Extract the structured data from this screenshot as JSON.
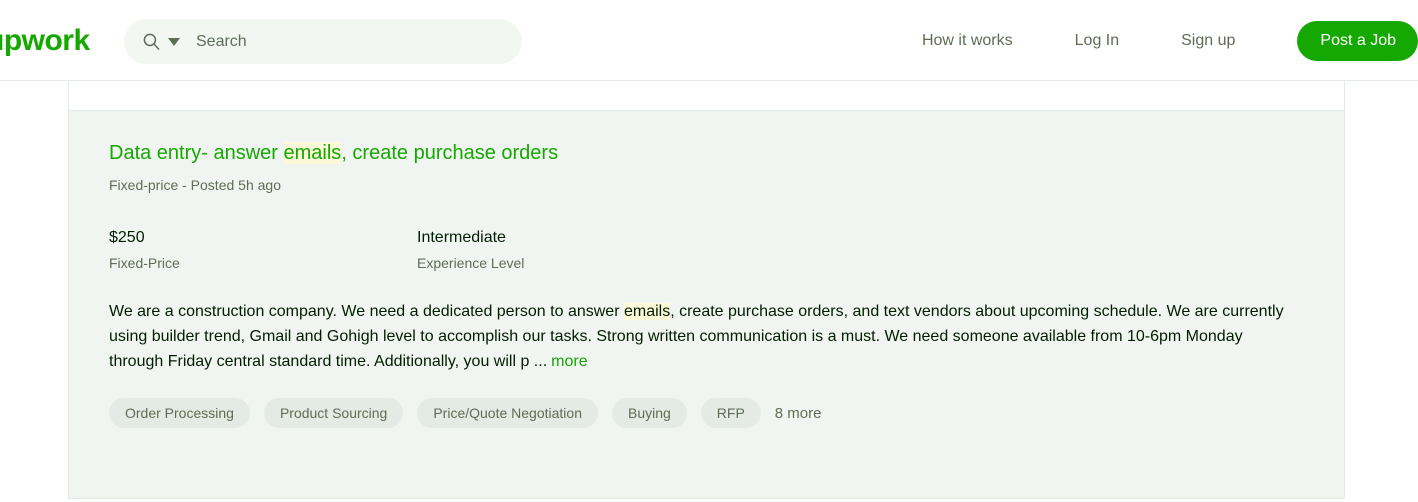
{
  "header": {
    "logo_text": "upwork",
    "logo_color": "#14a800",
    "search": {
      "placeholder": "Search",
      "value": "",
      "icon": "search-icon",
      "caret_icon": "chevron-down-icon"
    },
    "nav": [
      {
        "label": "How it works"
      },
      {
        "label": "Log In"
      },
      {
        "label": "Sign up"
      }
    ],
    "cta_label": "Post a Job"
  },
  "job": {
    "title_before": "Data entry- answer ",
    "title_highlight": "emails",
    "title_after": ", create purchase orders",
    "meta": "Fixed-price - Posted 5h ago",
    "stats": [
      {
        "value": "$250",
        "label": "Fixed-Price"
      },
      {
        "value": "Intermediate",
        "label": "Experience Level"
      }
    ],
    "description_before": "We are a construction company. We need a dedicated person to answer ",
    "description_highlight": "emails",
    "description_after": ", create purchase orders, and text vendors about upcoming schedule. We are currently using builder trend, Gmail and Gohigh level to accomplish our tasks. Strong written communication is a must. We need someone available from 10-6pm Monday through Friday central standard time. Additionally, you will p ...",
    "more_label": "more",
    "tags": [
      "Order Processing",
      "Product Sourcing",
      "Price/Quote Negotiation",
      "Buying",
      "RFP"
    ],
    "tags_more_label": "8 more"
  },
  "colors": {
    "brand_green": "#14a800",
    "card_bg": "#f1f5f1",
    "highlight": "#fcf8d9",
    "muted_text": "#5e6d55",
    "border": "#e4ebe4"
  }
}
